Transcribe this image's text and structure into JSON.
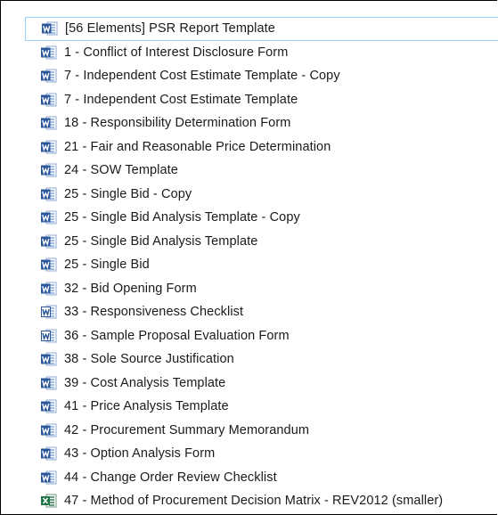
{
  "colors": {
    "word_blue": "#2b579a",
    "word_light": "#7ba3d9",
    "excel_green": "#217346",
    "selection_border": "#99d1ff",
    "text": "#1a1a1a"
  },
  "files": [
    {
      "name": "[56 Elements] PSR Report Template",
      "icon": "word-icon",
      "selected": true
    },
    {
      "name": "1 - Conflict of Interest Disclosure Form",
      "icon": "word-icon"
    },
    {
      "name": "7 - Independent Cost Estimate Template - Copy",
      "icon": "word-icon"
    },
    {
      "name": "7 - Independent Cost Estimate Template",
      "icon": "word-icon"
    },
    {
      "name": "18 - Responsibility Determination Form",
      "icon": "word-icon"
    },
    {
      "name": "21 - Fair and Reasonable Price Determination",
      "icon": "word-icon"
    },
    {
      "name": "24 - SOW Template",
      "icon": "word-icon"
    },
    {
      "name": "25 - Single Bid - Copy",
      "icon": "word-icon"
    },
    {
      "name": "25 - Single Bid Analysis Template - Copy",
      "icon": "word-icon"
    },
    {
      "name": "25 - Single Bid Analysis Template",
      "icon": "word-icon"
    },
    {
      "name": "25 - Single Bid",
      "icon": "word-icon"
    },
    {
      "name": "32 - Bid Opening Form",
      "icon": "word-icon"
    },
    {
      "name": "33 - Responsiveness Checklist",
      "icon": "word-legacy-icon"
    },
    {
      "name": "36 - Sample Proposal Evaluation Form",
      "icon": "word-legacy-icon"
    },
    {
      "name": "38 - Sole Source Justification",
      "icon": "word-icon"
    },
    {
      "name": "39 - Cost Analysis Template",
      "icon": "word-icon"
    },
    {
      "name": "41 - Price Analysis Template",
      "icon": "word-icon"
    },
    {
      "name": "42 - Procurement Summary Memorandum",
      "icon": "word-icon"
    },
    {
      "name": "43 - Option Analysis Form",
      "icon": "word-icon"
    },
    {
      "name": "44 - Change Order Review Checklist",
      "icon": "word-icon"
    },
    {
      "name": "47 - Method of Procurement Decision Matrix - REV2012 (smaller)",
      "icon": "excel-icon"
    }
  ]
}
